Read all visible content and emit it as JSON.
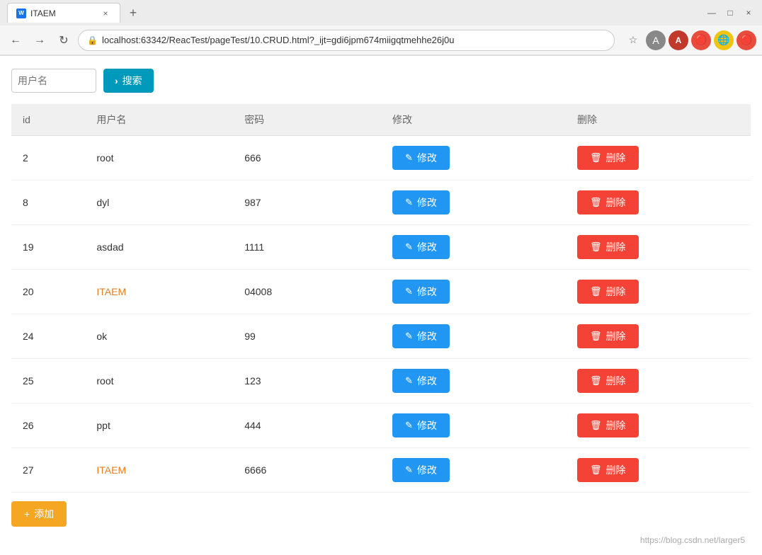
{
  "browser": {
    "tab": {
      "title": "ITAEM",
      "close_label": "×"
    },
    "new_tab_label": "+",
    "window_controls": {
      "minimize": "—",
      "maximize": "□",
      "close": "×"
    },
    "nav": {
      "back": "←",
      "forward": "→",
      "reload": "↻"
    },
    "address": "localhost:63342/ReacTest/pageTest/10.CRUD.html?_ijt=gdi6jpm674miigqtmehhe26j0u",
    "bookmark_icon": "☆",
    "account_label": "A",
    "ext_icons": [
      "A",
      "🔴",
      "🟡",
      "🔴"
    ]
  },
  "app": {
    "search": {
      "input_placeholder": "用户名",
      "button_label": "搜索"
    },
    "table": {
      "headers": [
        "id",
        "用户名",
        "密码",
        "修改",
        "删除"
      ],
      "rows": [
        {
          "id": "2",
          "username": "root",
          "username_highlight": false,
          "password": "666",
          "edit_label": "修改",
          "delete_label": "删除"
        },
        {
          "id": "8",
          "username": "dyl",
          "username_highlight": false,
          "password": "987",
          "edit_label": "修改",
          "delete_label": "删除"
        },
        {
          "id": "19",
          "username": "asdad",
          "username_highlight": false,
          "password": "1111",
          "edit_label": "修改",
          "delete_label": "删除"
        },
        {
          "id": "20",
          "username": "ITAEM",
          "username_highlight": true,
          "password": "04008",
          "edit_label": "修改",
          "delete_label": "删除"
        },
        {
          "id": "24",
          "username": "ok",
          "username_highlight": false,
          "password": "99",
          "edit_label": "修改",
          "delete_label": "删除"
        },
        {
          "id": "25",
          "username": "root",
          "username_highlight": false,
          "password": "123",
          "edit_label": "修改",
          "delete_label": "删除"
        },
        {
          "id": "26",
          "username": "ppt",
          "username_highlight": false,
          "password": "444",
          "edit_label": "修改",
          "delete_label": "删除"
        },
        {
          "id": "27",
          "username": "ITAEM",
          "username_highlight": true,
          "password": "6666",
          "edit_label": "修改",
          "delete_label": "删除"
        }
      ]
    },
    "add_button_label": "添加",
    "watermark": "https://blog.csdn.net/larger5"
  }
}
